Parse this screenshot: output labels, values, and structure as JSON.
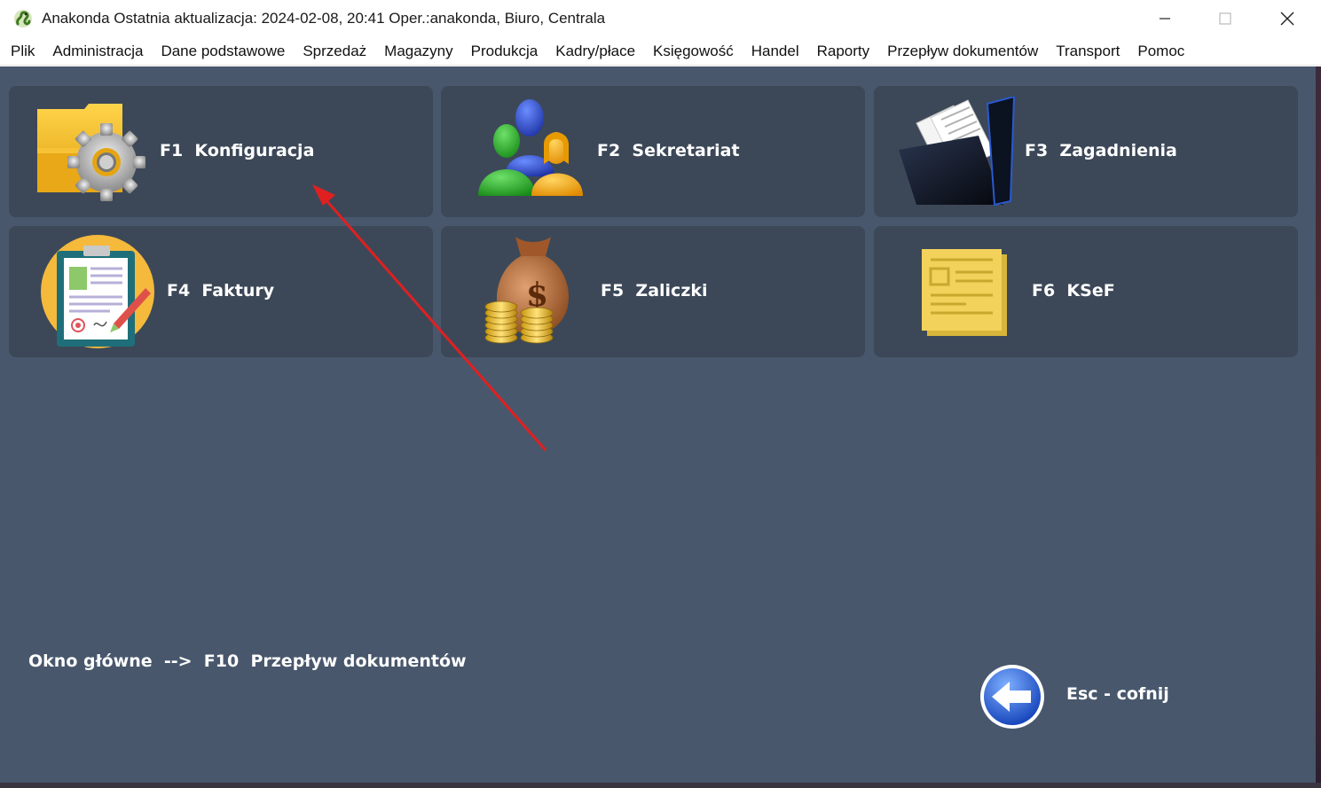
{
  "window": {
    "title": "Anakonda Ostatnia aktualizacja: 2024-02-08, 20:41 Oper.:anakonda, Biuro, Centrala",
    "icon": "snake-app-icon",
    "controls": [
      "minimize-icon",
      "maximize-icon",
      "close-icon"
    ]
  },
  "menu": {
    "items": [
      {
        "label": "Plik"
      },
      {
        "label": "Administracja"
      },
      {
        "label": "Dane podstawowe"
      },
      {
        "label": "Sprzedaż"
      },
      {
        "label": "Magazyny"
      },
      {
        "label": "Produkcja"
      },
      {
        "label": "Kadry/płace"
      },
      {
        "label": "Księgowość"
      },
      {
        "label": "Handel"
      },
      {
        "label": "Raporty"
      },
      {
        "label": "Przepływ dokumentów"
      },
      {
        "label": "Transport"
      },
      {
        "label": "Pomoc"
      }
    ]
  },
  "tiles": [
    {
      "label": "F1  Konfiguracja",
      "icon": "folder-gear-icon"
    },
    {
      "label": "F2  Sekretariat",
      "icon": "people-icon"
    },
    {
      "label": "F3  Zagadnienia",
      "icon": "black-folder-documents-icon"
    },
    {
      "label": "F4  Faktury",
      "icon": "clipboard-invoice-icon"
    },
    {
      "label": "F5  Zaliczki",
      "icon": "money-bag-coins-icon"
    },
    {
      "label": "F6  KSeF",
      "icon": "yellow-document-icon"
    }
  ],
  "footer": {
    "path": "Okno główne  -->  F10  Przepływ dokumentów",
    "back_label": "Esc - cofnij",
    "back_icon": "back-arrow-icon"
  },
  "colors": {
    "background": "#48576c",
    "tile": "#3c4858",
    "text": "#ffffff",
    "annotation_arrow": "#e02020"
  }
}
